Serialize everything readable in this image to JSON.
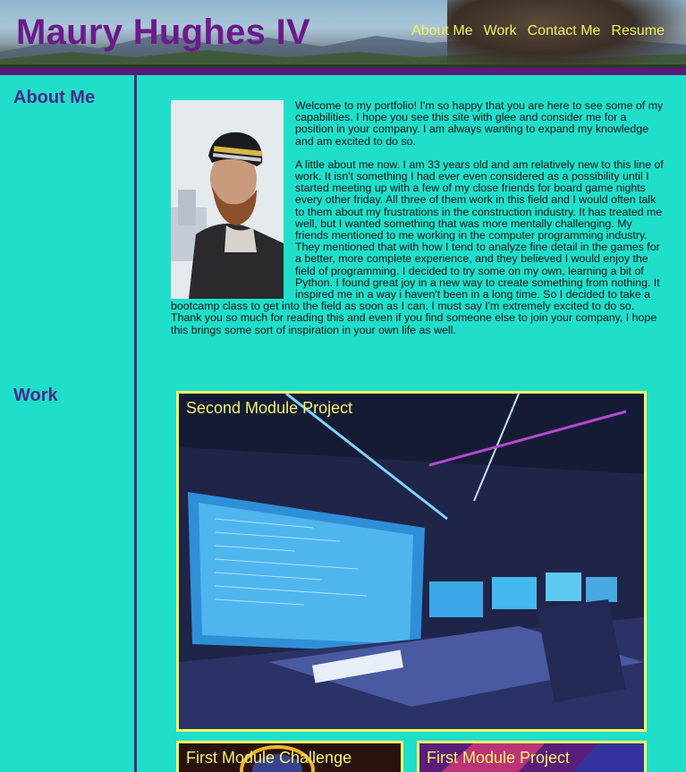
{
  "header": {
    "title": "Maury Hughes IV",
    "nav": [
      "About Me",
      "Work",
      "Contact Me",
      "Resume"
    ]
  },
  "about": {
    "heading": "About Me",
    "paragraphs": [
      "Welcome to my portfolio! I'm so happy that you are here to see some of my capabilities. I hope you see this site with glee and consider me for a position in your company. I am always wanting to expand my knowledge and am excited to do so.",
      "A little about me now. I am 33 years old and am relatively new to this line of work. It isn't something I had ever even considered as a possibility until I started meeting up with a few of my close friends for board game nights every other friday. All three of them work in this field and I would often talk to them about my frustrations in the construction industry. It has treated me well, but I wanted something that was more mentally challenging. My friends mentioned to me working in the computer programming industry. They mentioned that with how I tend to analyze fine detail in the games for a better, more complete experience, and they believed I would enjoy the field of programming. I decided to try some on my own, learning a bit of Python. I found great joy in a new way to create something from nothing. It inspired me in a way i haven't been in a long time. So I decided to take a bootcamp class to get into the field as soon as I can. I must say I'm extremely excited to do so. Thank you so much for reading this and even if you find someone else to join your company, I hope this brings some sort of inspiration in your own life as well."
    ]
  },
  "work": {
    "heading": "Work",
    "projects": [
      {
        "title": "Second Module Project"
      },
      {
        "title": "First Module Challenge"
      },
      {
        "title": "First Module Project"
      }
    ]
  },
  "colors": {
    "background": "#1fdfcb",
    "title": "#6b1a8a",
    "nav": "#f2f25a",
    "accent_bar": "#5b1a78",
    "card_border": "#f4f46a"
  }
}
